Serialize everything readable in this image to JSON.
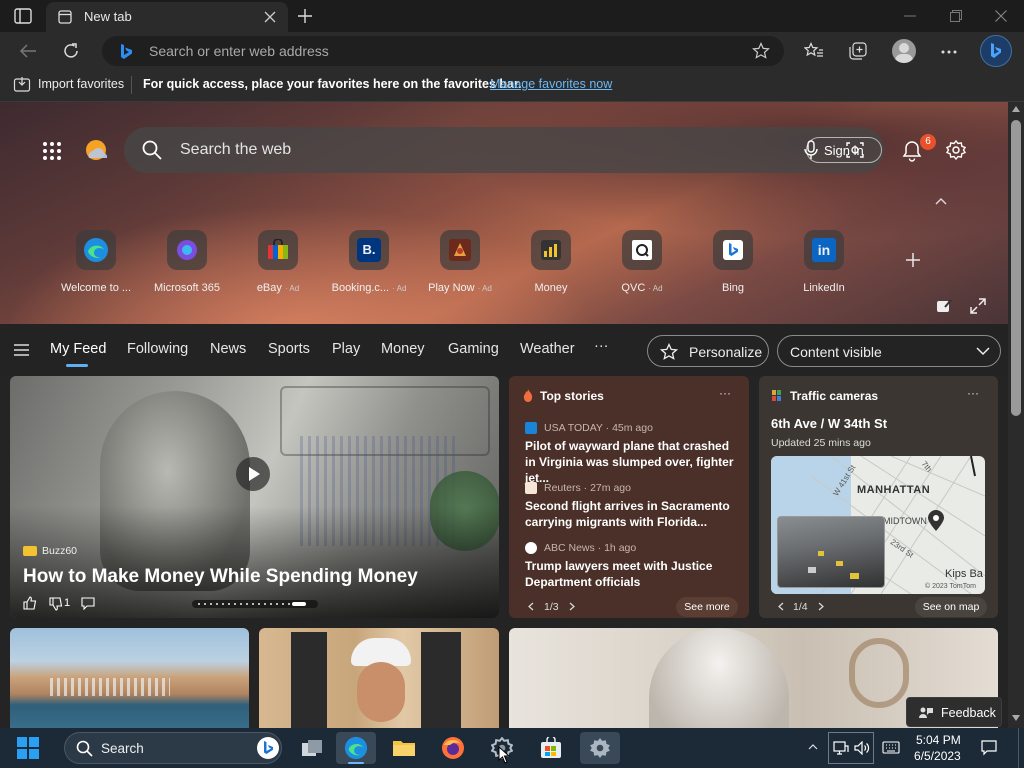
{
  "browser": {
    "tab_title": "New tab",
    "address_placeholder": "Search or enter web address"
  },
  "favorites_bar": {
    "import_label": "Import favorites",
    "message": "For quick access, place your favorites here on the favorites bar.",
    "manage_link": "Manage favorites now"
  },
  "newtab": {
    "search_placeholder": "Search the web",
    "sign_in": "Sign in",
    "notification_count": "6",
    "quick_links": [
      {
        "label": "Welcome to ...",
        "ad": ""
      },
      {
        "label": "Microsoft 365",
        "ad": ""
      },
      {
        "label": "eBay",
        "ad": "· Ad"
      },
      {
        "label": "Booking.c...",
        "ad": "· Ad"
      },
      {
        "label": "Play Now",
        "ad": "· Ad"
      },
      {
        "label": "Money",
        "ad": ""
      },
      {
        "label": "QVC",
        "ad": "· Ad"
      },
      {
        "label": "Bing",
        "ad": ""
      },
      {
        "label": "LinkedIn",
        "ad": ""
      }
    ]
  },
  "feed_nav": {
    "tabs": [
      "My Feed",
      "Following",
      "News",
      "Sports",
      "Play",
      "Money",
      "Gaming",
      "Weather"
    ],
    "more": "···",
    "personalize": "Personalize",
    "content_visible": "Content visible"
  },
  "main_card": {
    "source": "Buzz60",
    "title": "How to Make Money While Spending Money",
    "dislike_count": "1"
  },
  "top_stories": {
    "title": "Top stories",
    "items": [
      {
        "source": "USA TODAY · 45m ago",
        "headline": "Pilot of wayward plane that crashed in Virginia was slumped over, fighter jet..."
      },
      {
        "source": "Reuters · 27m ago",
        "headline": "Second flight arrives in Sacramento carrying migrants with Florida..."
      },
      {
        "source": "ABC News · 1h ago",
        "headline": "Trump lawyers meet with Justice Department officials"
      }
    ],
    "pager": "1/3",
    "see_more": "See more"
  },
  "traffic": {
    "title": "Traffic cameras",
    "location": "6th Ave / W 34th St",
    "updated": "Updated 25 mins ago",
    "map_labels": [
      "MANHATTAN",
      "7th",
      "W 41st St",
      "MIDTOWN",
      "23rd St",
      "Kips Ba",
      "© 2023 TomTom"
    ],
    "pager": "1/4",
    "see_on_map": "See on map"
  },
  "feedback": "Feedback",
  "taskbar": {
    "search": "Search",
    "time": "5:04 PM",
    "date": "6/5/2023"
  },
  "colors": {
    "accent_link": "#6cb8f6",
    "badge": "#e8512b",
    "bing_blue": "#1b76d3"
  }
}
